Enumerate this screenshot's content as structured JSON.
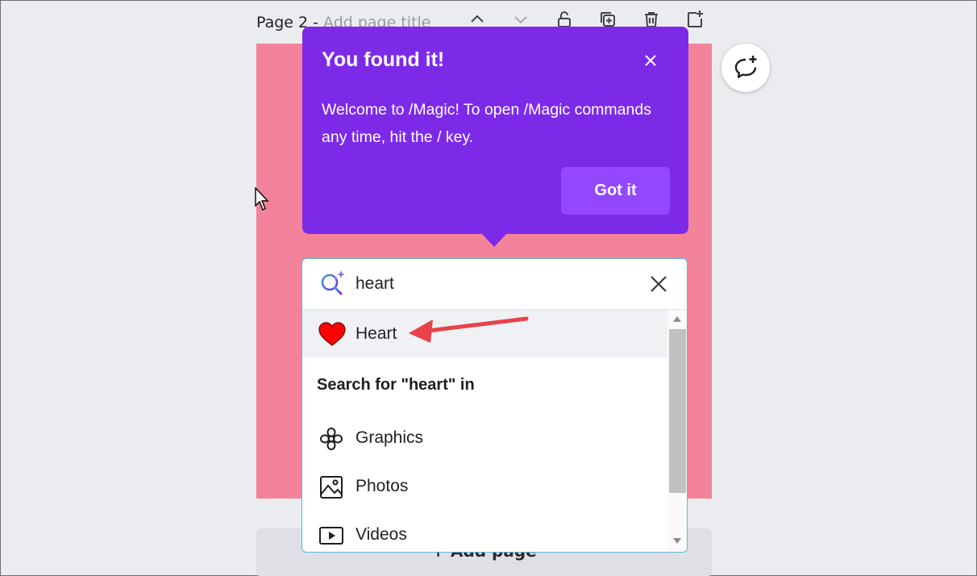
{
  "header": {
    "page_label": "Page 2 -",
    "page_title_placeholder": "Add page title"
  },
  "add_page_label": "+ Add page",
  "popover": {
    "title": "You found it!",
    "body": "Welcome to /Magic! To open /Magic commands any time, hit the / key.",
    "button_label": "Got it",
    "color": "#7d2ae8"
  },
  "search": {
    "value": "heart",
    "top_result": "Heart",
    "section_heading": "Search for \"heart\" in",
    "options": [
      {
        "label": "Graphics",
        "icon": "flower-icon"
      },
      {
        "label": "Photos",
        "icon": "image-icon"
      },
      {
        "label": "Videos",
        "icon": "video-icon"
      }
    ]
  },
  "canvas_color": "#f2839b",
  "annotation_color": "#e8424a"
}
